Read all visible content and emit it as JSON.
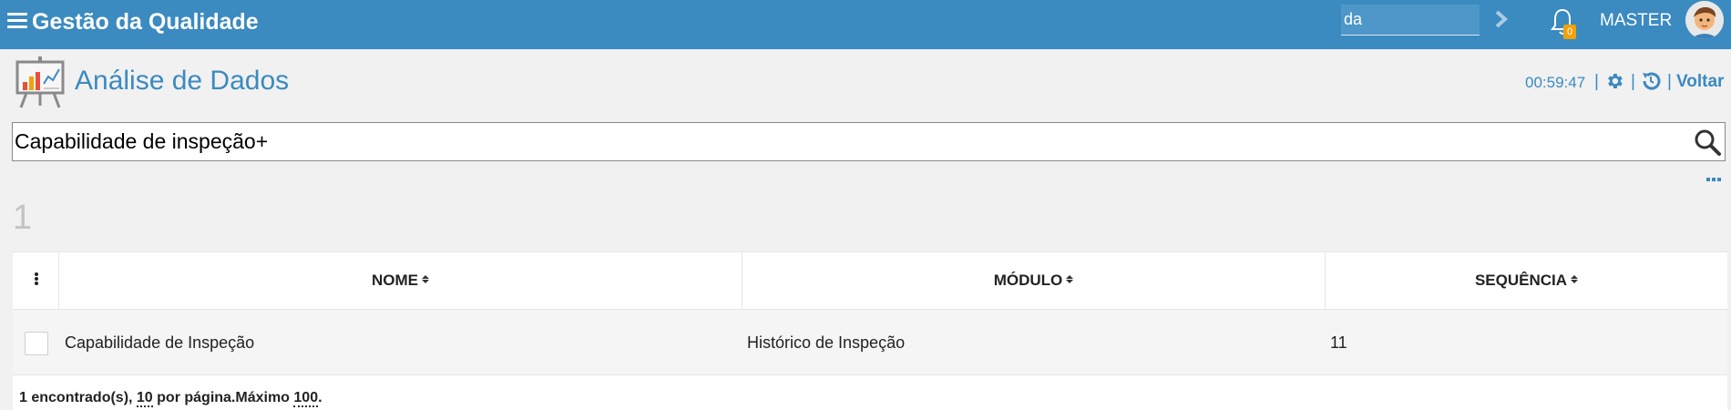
{
  "app": {
    "title": "Gestão da Qualidade",
    "search_value": "da",
    "notifications_count": "0",
    "user_name": "MASTER",
    "accent_color": "#3b8ac0",
    "badge_color": "#f2a10c"
  },
  "page": {
    "title": "Análise de Dados",
    "clock": "00:59:47",
    "separator": "|",
    "back_label": "Voltar"
  },
  "search": {
    "value": "Capabilidade de inspeção+"
  },
  "results": {
    "count": "1",
    "columns": [
      "NOME",
      "MÓDULO",
      "SEQUÊNCIA"
    ],
    "rows": [
      {
        "nome": "Capabilidade de Inspeção",
        "modulo": "Histórico de Inspeção",
        "sequencia": "11"
      }
    ],
    "footer": {
      "found": "1 encontrado(s), ",
      "per_page": "10",
      "per_page_suffix": " por página.Máximo ",
      "max": "100",
      "end": "."
    }
  },
  "icons": {
    "menu": "menu-icon",
    "search_go": "chevron-right-icon",
    "bell": "bell-icon",
    "page": "presentation-chart-icon",
    "gear": "gear-icon",
    "refresh": "history-icon",
    "magnifier": "search-icon",
    "more": "more-options-icon",
    "column_menu": "vertical-dots-icon"
  }
}
